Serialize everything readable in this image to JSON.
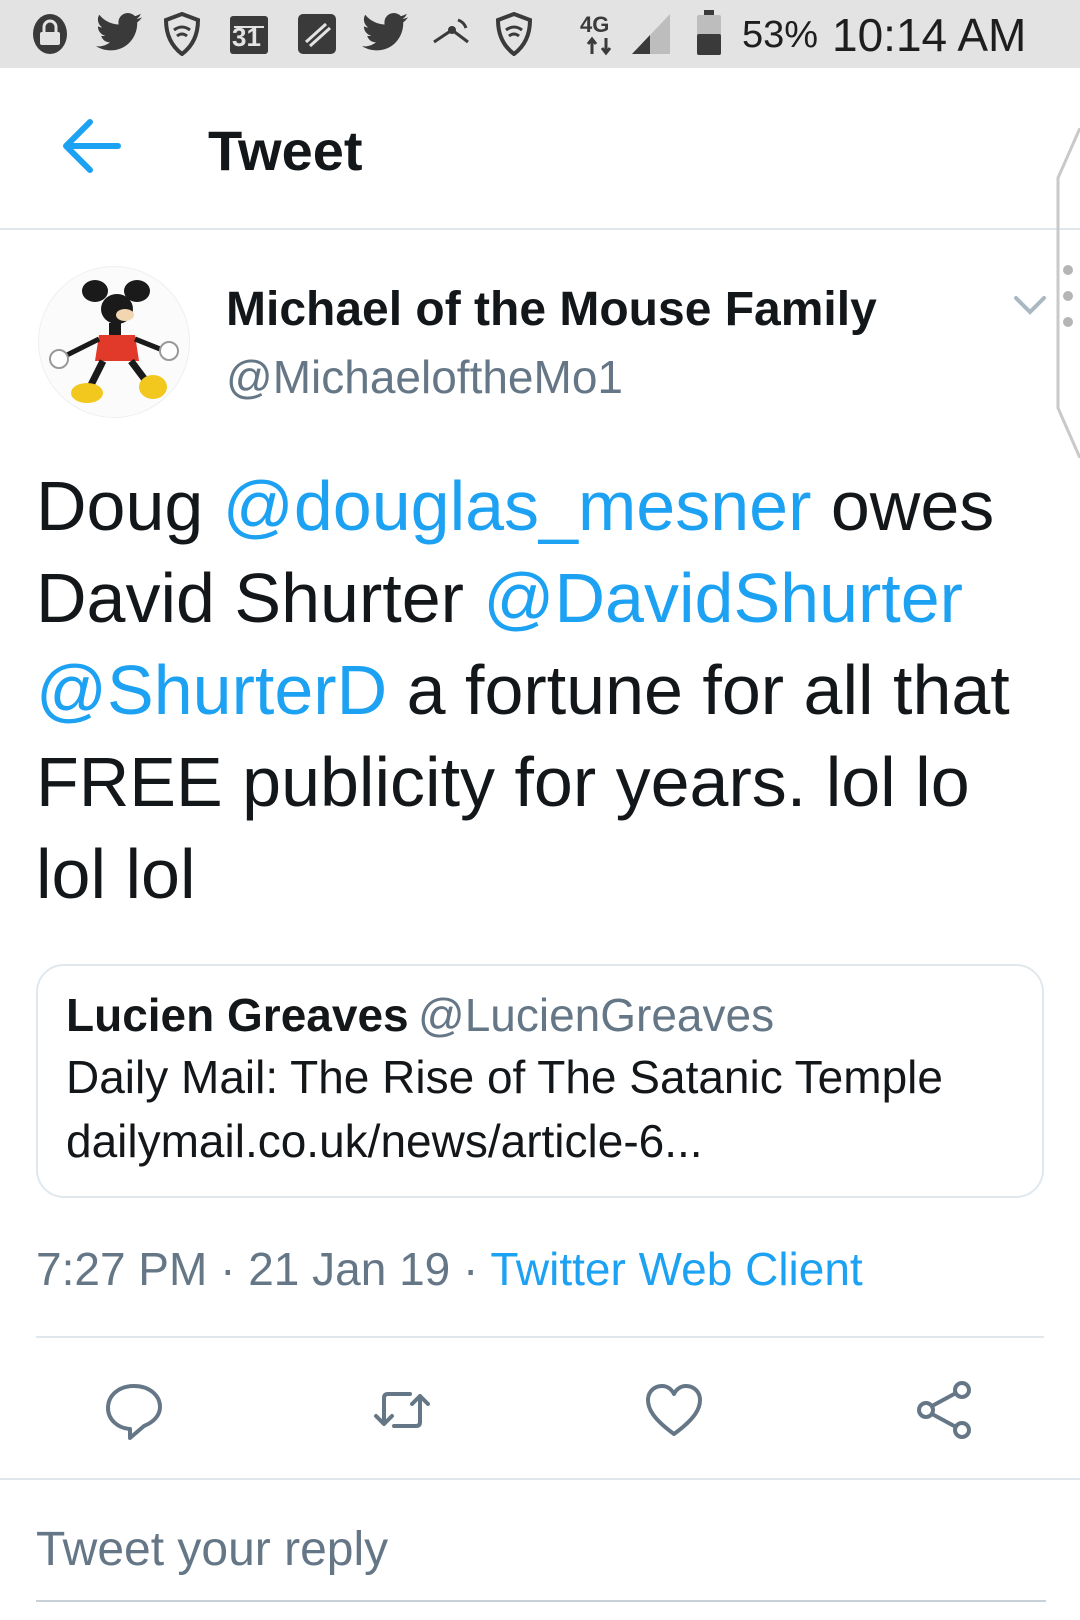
{
  "status_bar": {
    "calendar_day": "31",
    "network": "4G",
    "battery_percent": "53%",
    "time": "10:14 AM",
    "icons": [
      "lock-icon",
      "twitter-icon",
      "shield-icon",
      "calendar-icon",
      "blackberry-icon",
      "twitter-icon",
      "satellite-icon",
      "shield-icon",
      "network-4g-icon",
      "signal-icon",
      "battery-icon"
    ]
  },
  "header": {
    "title": "Tweet"
  },
  "tweet": {
    "author_name": "Michael of the Mouse Family",
    "author_handle": "@MichaeloftheMo1",
    "text_parts": [
      {
        "t": "Doug ",
        "mention": false
      },
      {
        "t": "@douglas_mesner",
        "mention": true
      },
      {
        "t": " owes David Shurter ",
        "mention": false
      },
      {
        "t": "@DavidShurter",
        "mention": true
      },
      {
        "t": " ",
        "mention": false
      },
      {
        "t": "@ShurterD",
        "mention": true
      },
      {
        "t": " a fortune for all that FREE publicity for years. lol lo lol lol",
        "mention": false
      }
    ],
    "quote": {
      "name": "Lucien Greaves",
      "handle": "@LucienGreaves",
      "line1": "Daily Mail: The Rise of The Satanic Temple",
      "line2": "dailymail.co.uk/news/article-6..."
    },
    "time": "7:27 PM",
    "sep1": " · ",
    "date": "21 Jan 19",
    "sep2": " · ",
    "source": "Twitter Web Client"
  },
  "reply": {
    "placeholder": "Tweet your reply"
  },
  "colors": {
    "accent": "#1da1f2",
    "text": "#14171a",
    "secondary": "#657786",
    "status_bar_bg": "#e3e3e3",
    "border": "#e1e8ed"
  }
}
